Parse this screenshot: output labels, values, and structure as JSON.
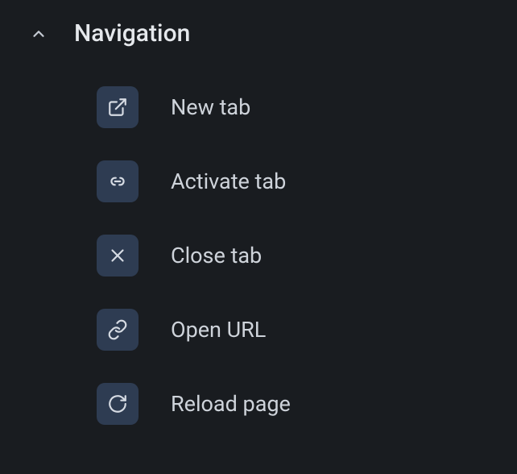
{
  "section": {
    "title": "Navigation"
  },
  "items": [
    {
      "label": "New tab",
      "icon": "external-link-icon",
      "name": "new-tab-item"
    },
    {
      "label": "Activate tab",
      "icon": "link-icon",
      "name": "activate-tab-item"
    },
    {
      "label": "Close tab",
      "icon": "close-icon",
      "name": "close-tab-item"
    },
    {
      "label": "Open URL",
      "icon": "chain-link-icon",
      "name": "open-url-item"
    },
    {
      "label": "Reload page",
      "icon": "reload-icon",
      "name": "reload-page-item"
    }
  ]
}
